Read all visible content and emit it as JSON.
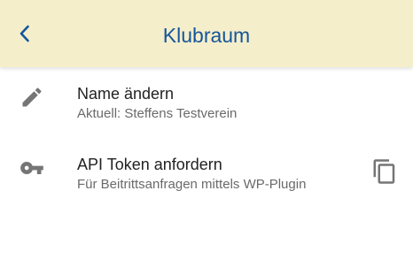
{
  "header": {
    "title": "Klubraum",
    "back_icon": "chevron-left-icon",
    "background_color": "#f5eecb",
    "accent_color": "#14569a"
  },
  "items": [
    {
      "icon": "pencil-icon",
      "title": "Name ändern",
      "subtitle": "Aktuell: Steffens Testverein"
    },
    {
      "icon": "key-icon",
      "title": "API Token anfordern",
      "subtitle": "Für Beitrittsanfragen mittels WP-Plugin",
      "action_icon": "copy-icon"
    }
  ]
}
